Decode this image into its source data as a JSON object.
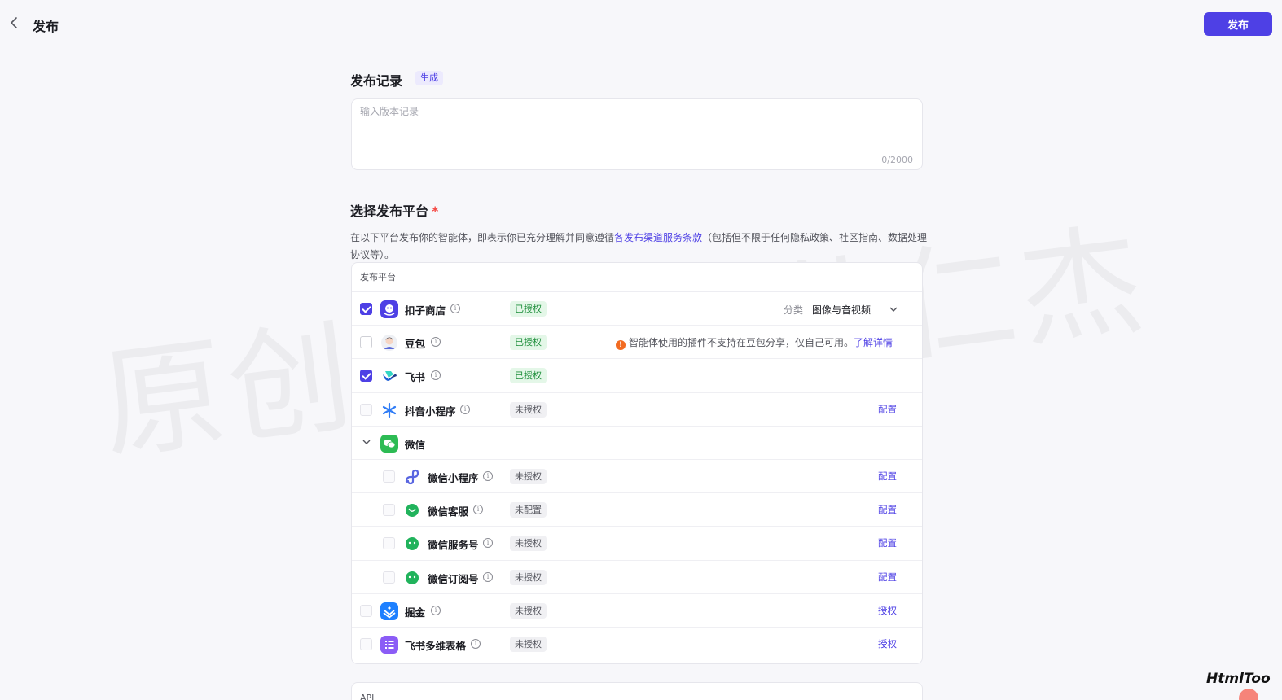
{
  "header": {
    "title": "发布",
    "publish_label": "发布"
  },
  "watermark": "原创内容BY黄仁杰",
  "record": {
    "title": "发布记录",
    "generate_label": "生成",
    "placeholder": "输入版本记录",
    "counter": "0/2000"
  },
  "platform_section": {
    "title": "选择发布平台",
    "required_mark": "*",
    "desc_before": "在以下平台发布你的智能体，即表示你已充分理解并同意遵循",
    "desc_link": "各发布渠道服务条款",
    "desc_after": "（包括但不限于任何隐私政策、社区指南、数据处理协议等）。",
    "table_header": "发布平台"
  },
  "platforms": [
    {
      "name": "扣子商店",
      "status": "已授权",
      "checked": true,
      "category_label": "分类",
      "category_value": "图像与音视频"
    },
    {
      "name": "豆包",
      "status": "已授权",
      "checked": false,
      "warning": "智能体使用的插件不支持在豆包分享，仅自己可用。",
      "warning_link": "了解详情"
    },
    {
      "name": "飞书",
      "status": "已授权",
      "checked": true
    },
    {
      "name": "抖音小程序",
      "status": "未授权",
      "checked": false,
      "action": "配置"
    },
    {
      "name": "微信"
    },
    {
      "name": "微信小程序",
      "status": "未授权",
      "checked": false,
      "action": "配置"
    },
    {
      "name": "微信客服",
      "status": "未配置",
      "checked": false,
      "action": "配置"
    },
    {
      "name": "微信服务号",
      "status": "未授权",
      "checked": false,
      "action": "配置"
    },
    {
      "name": "微信订阅号",
      "status": "未授权",
      "checked": false,
      "action": "配置"
    },
    {
      "name": "掘金",
      "status": "未授权",
      "checked": false,
      "action": "授权"
    },
    {
      "name": "飞书多维表格",
      "status": "未授权",
      "checked": false,
      "action": "授权"
    }
  ],
  "api_section": {
    "label": "API"
  },
  "brand": "HtmlToo",
  "colors": {
    "accent": "#4e40e5",
    "authorized_bg": "#e4f7e8",
    "authorized_text": "#1f8f3c",
    "warning": "#f26b21"
  }
}
